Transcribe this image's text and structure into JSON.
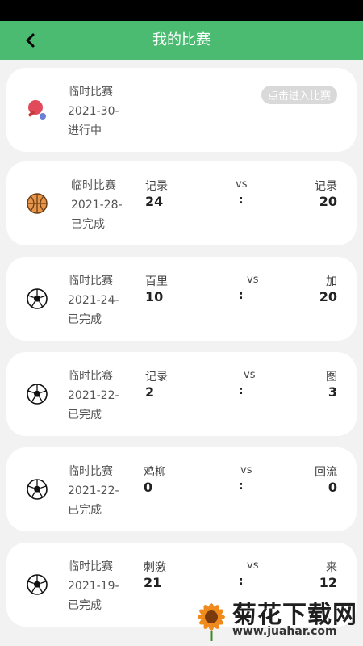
{
  "header": {
    "title": "我的比赛"
  },
  "matches": [
    {
      "sport_icon": "ping-pong-icon",
      "name": "临时比赛",
      "date": "2021-30-",
      "status": "进行中",
      "action": "点击进入比赛"
    },
    {
      "sport_icon": "basketball-icon",
      "name": "临时比赛",
      "date": "2021-28-",
      "status": "已完成",
      "team_a": "记录",
      "team_b": "记录",
      "vs": "vs",
      "score_a": "24",
      "score_b": "20",
      "sep": ":"
    },
    {
      "sport_icon": "soccer-ball-icon",
      "name": "临时比赛",
      "date": "2021-24-",
      "status": "已完成",
      "team_a": "百里",
      "team_b": "加",
      "vs": "vs",
      "score_a": "10",
      "score_b": "20",
      "sep": ":"
    },
    {
      "sport_icon": "soccer-ball-icon",
      "name": "临时比赛",
      "date": "2021-22-",
      "status": "已完成",
      "team_a": "记录",
      "team_b": "图",
      "vs": "vs",
      "score_a": "2",
      "score_b": "3",
      "sep": ":"
    },
    {
      "sport_icon": "soccer-ball-icon",
      "name": "临时比赛",
      "date": "2021-22-",
      "status": "已完成",
      "team_a": "鸡柳",
      "team_b": "回流",
      "vs": "vs",
      "score_a": "0",
      "score_b": "0",
      "sep": ":"
    },
    {
      "sport_icon": "soccer-ball-icon",
      "name": "临时比赛",
      "date": "2021-19-",
      "status": "已完成",
      "team_a": "刺激",
      "team_b": "来",
      "vs": "vs",
      "score_a": "21",
      "score_b": "12",
      "sep": ":"
    }
  ],
  "watermark": {
    "brand": "菊花下载网",
    "url": "www.juahar.com"
  },
  "colors": {
    "header": "#4cbb72",
    "card": "#ffffff",
    "background": "#f2f2f2",
    "button": "#d9d9d9"
  }
}
